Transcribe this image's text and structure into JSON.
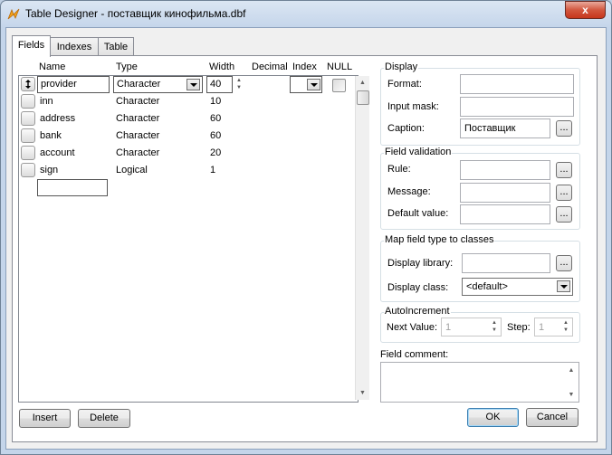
{
  "window": {
    "title": "Table Designer - поставщик кинофильма.dbf",
    "close_glyph": "x"
  },
  "tabs": [
    {
      "label": "Fields"
    },
    {
      "label": "Indexes"
    },
    {
      "label": "Table"
    }
  ],
  "grid": {
    "headers": {
      "name": "Name",
      "type": "Type",
      "width": "Width",
      "decimal": "Decimal",
      "index": "Index",
      "null": "NULL"
    },
    "rows": [
      {
        "name": "provider",
        "type": "Character",
        "width": "40"
      },
      {
        "name": "inn",
        "type": "Character",
        "width": "10"
      },
      {
        "name": "address",
        "type": "Character",
        "width": "60"
      },
      {
        "name": "bank",
        "type": "Character",
        "width": "60"
      },
      {
        "name": "account",
        "type": "Character",
        "width": "20"
      },
      {
        "name": "sign",
        "type": "Logical",
        "width": "1"
      }
    ],
    "new_row_name": ""
  },
  "display": {
    "title": "Display",
    "format_label": "Format:",
    "format_value": "",
    "input_mask_label": "Input mask:",
    "input_mask_value": "",
    "caption_label": "Caption:",
    "caption_value": "Поставщик"
  },
  "validation": {
    "title": "Field validation",
    "rule_label": "Rule:",
    "rule_value": "",
    "message_label": "Message:",
    "message_value": "",
    "default_label": "Default value:",
    "default_value": ""
  },
  "classes": {
    "title": "Map field type to classes",
    "library_label": "Display library:",
    "library_value": "",
    "class_label": "Display class:",
    "class_value": "<default>"
  },
  "autoinc": {
    "title": "AutoIncrement",
    "next_label": "Next Value:",
    "next_value": "1",
    "step_label": "Step:",
    "step_value": "1"
  },
  "comment": {
    "label": "Field comment:",
    "value": ""
  },
  "buttons": {
    "insert": "Insert",
    "delete": "Delete",
    "ok": "OK",
    "cancel": "Cancel",
    "dots": "..."
  },
  "icons": [
    "app-icon",
    "close-icon",
    "row-selector-icon",
    "combo-arrow-icon",
    "spin-up-icon",
    "spin-down-icon",
    "scroll-up-icon",
    "scroll-down-icon"
  ]
}
